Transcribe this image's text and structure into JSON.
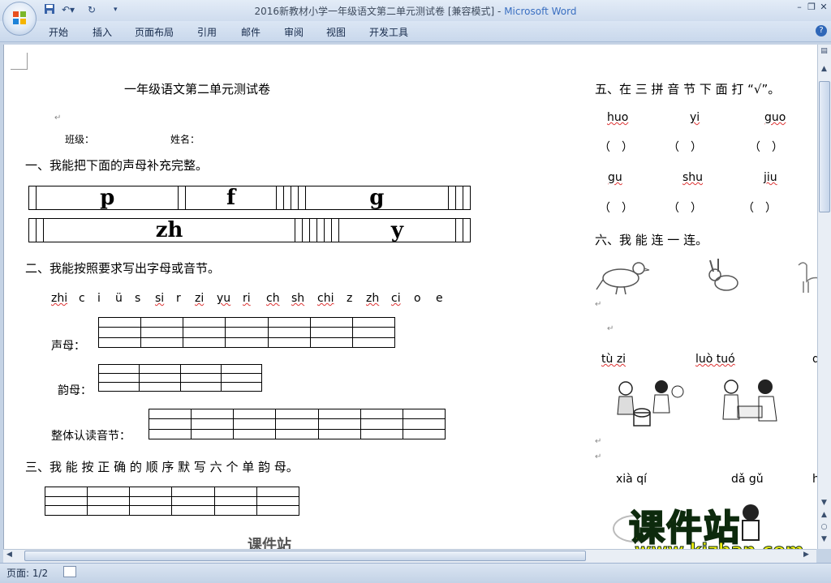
{
  "window": {
    "title": "2016新教材小学一年级语文第二单元测试卷 [兼容模式] - ",
    "app_name": "Microsoft Word",
    "qat_items": [
      "save",
      "undo",
      "redo",
      "customize"
    ]
  },
  "ribbon": {
    "tabs": [
      "开始",
      "插入",
      "页面布局",
      "引用",
      "邮件",
      "审阅",
      "视图",
      "开发工具"
    ]
  },
  "document": {
    "title": "一年级语文第二单元测试卷",
    "class_label": "班级：",
    "name_label": "姓名：",
    "section1": "一、我能把下面的声母补充完整。",
    "grid1_row1": [
      "",
      "p",
      "",
      "f",
      "",
      "",
      "",
      "",
      "g",
      "",
      "",
      ""
    ],
    "grid1_row2": [
      "",
      "",
      "zh",
      "",
      "",
      "",
      "",
      "",
      "",
      "y",
      "",
      ""
    ],
    "section2": "二、我能按照要求写出字母或音节。",
    "letters": [
      "zhi",
      "c",
      "i",
      "ü",
      "s",
      "si",
      "r",
      "zi",
      "yu",
      "ri",
      "ch",
      "sh",
      "chi",
      "z",
      "zh",
      "ci",
      "o",
      "e"
    ],
    "shengmu_label": "声母：",
    "yunmu_label": "韵母：",
    "zhengti_label": "整体认读音节：",
    "section3": "三、我 能 按 正 确 的 顺 序 默 写 六 个 单 韵 母。",
    "section5": "五、在 三 拼 音 节 下 面 打 “√”。",
    "s5_row1": [
      "huo",
      "yi",
      "guo"
    ],
    "s5_row2": [
      "gu",
      "shu",
      "jiu"
    ],
    "paren": "（　）",
    "section6": "六、我 能 连 一 连。",
    "s6_pinyin1": [
      "tù zi",
      "luò tuó",
      "d"
    ],
    "s6_pinyin2": [
      "xià qí",
      "dǎ gǔ",
      "h"
    ],
    "watermark_small": "课件站",
    "watermark_big": "课件站",
    "watermark_url": "www.kjzhan.com"
  },
  "status": {
    "page": "页面: 1/2"
  }
}
